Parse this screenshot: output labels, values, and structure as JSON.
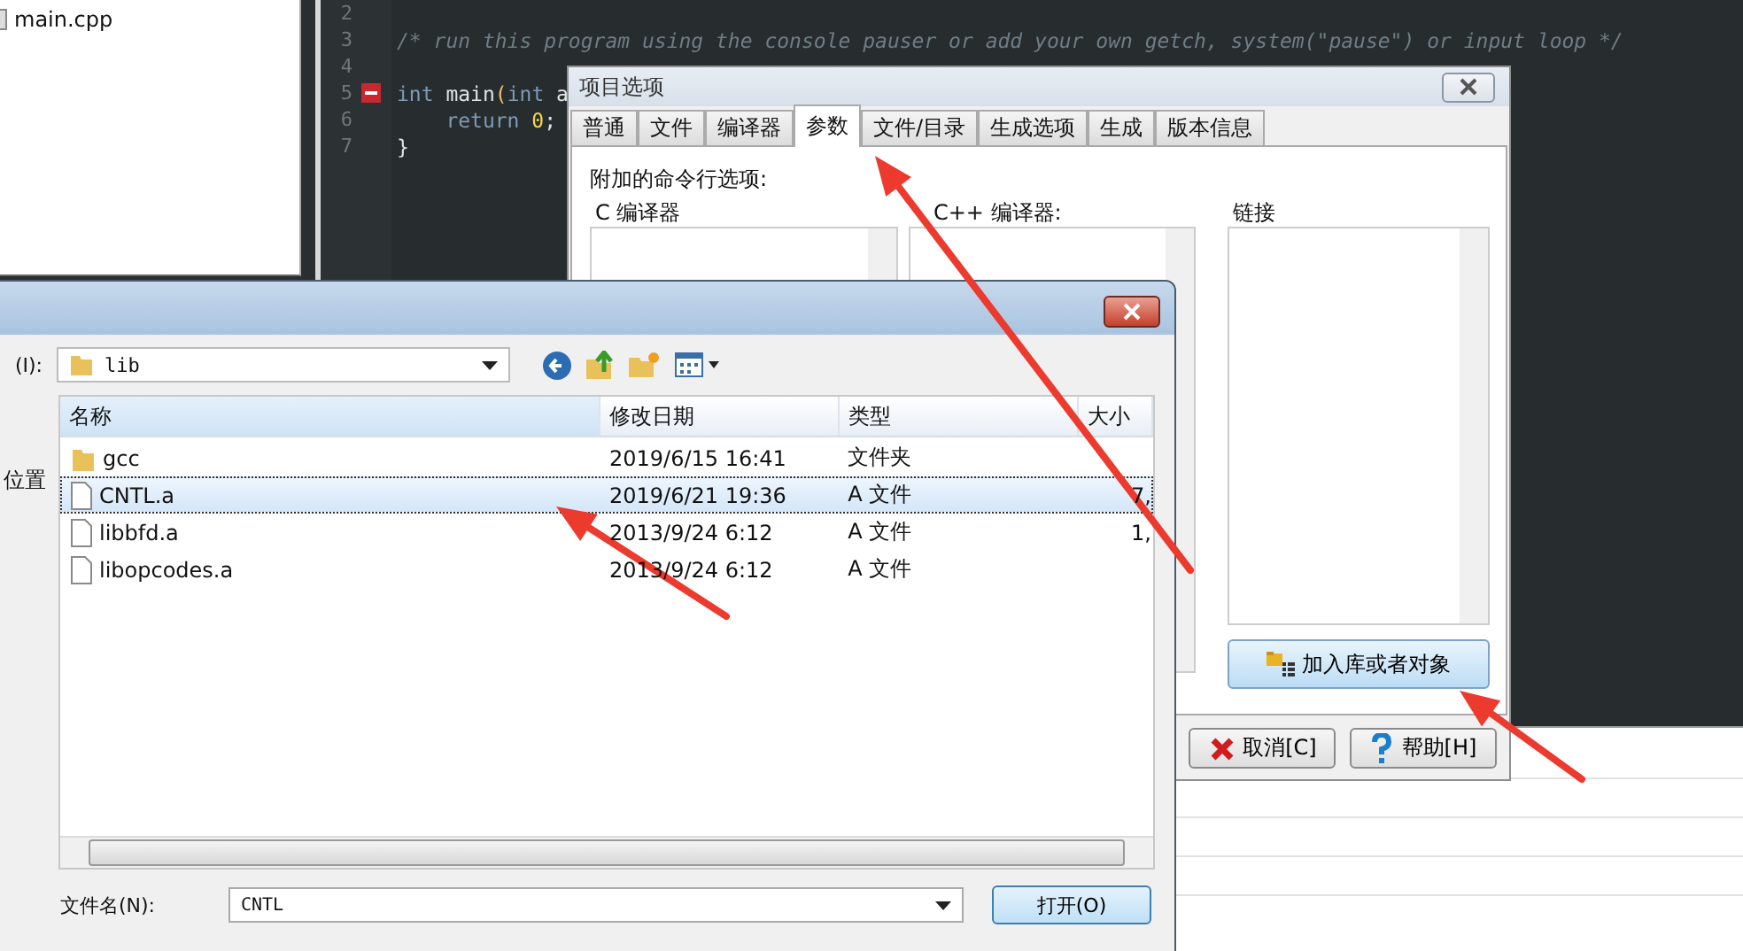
{
  "project_tree": {
    "items": [
      {
        "label": "main.cpp"
      }
    ]
  },
  "editor": {
    "lines": [
      {
        "number": "2"
      },
      {
        "number": "3",
        "tokens": [
          {
            "text": "/* run this program using the console pauser or add your own getch, system(\"pause\") or input loop */",
            "kind": "comment"
          }
        ]
      },
      {
        "number": "4"
      },
      {
        "number": "5",
        "fold": {
          "expanded": true
        },
        "tokens": [
          {
            "text": "int",
            "kind": "keyword"
          },
          {
            "text": " main",
            "kind": "plain"
          },
          {
            "text": "(",
            "kind": "paren"
          },
          {
            "text": "int",
            "kind": "keyword"
          },
          {
            "text": " a",
            "kind": "plain"
          }
        ]
      },
      {
        "number": "6",
        "tokens": [
          {
            "text": "    return",
            "kind": "keyword"
          },
          {
            "text": " 0",
            "kind": "number"
          },
          {
            "text": ";",
            "kind": "plain"
          }
        ]
      },
      {
        "number": "7",
        "tokens": [
          {
            "text": "}",
            "kind": "plain"
          }
        ]
      }
    ]
  },
  "project_options": {
    "title": "项目选项",
    "tabs": [
      {
        "label": "普通",
        "selected": false
      },
      {
        "label": "文件",
        "selected": false
      },
      {
        "label": "编译器",
        "selected": false
      },
      {
        "label": "参数",
        "selected": true
      },
      {
        "label": "文件/目录",
        "selected": false
      },
      {
        "label": "生成选项",
        "selected": false
      },
      {
        "label": "生成",
        "selected": false
      },
      {
        "label": "版本信息",
        "selected": false
      }
    ],
    "section_label": "附加的命令行选项:",
    "columns": [
      {
        "label": "C 编译器"
      },
      {
        "label": "C++ 编译器:"
      },
      {
        "label": "链接"
      }
    ],
    "add_button": "加入库或者对象",
    "buttons": [
      {
        "label": "取消[C]",
        "kind": "cancel"
      },
      {
        "label": "帮助[H]",
        "kind": "help"
      }
    ]
  },
  "file_dialog": {
    "look_in_label": "(I):",
    "look_in": "lib",
    "nav_label": "位置",
    "columns": [
      "名称",
      "修改日期",
      "类型",
      "大小"
    ],
    "rows": [
      {
        "name": "gcc",
        "date": "2019/6/15 16:41",
        "type": "文件夹",
        "kind": "folder",
        "selected": false
      },
      {
        "name": "CNTL.a",
        "date": "2019/6/21 19:36",
        "type": "A 文件",
        "size": "7,",
        "kind": "file",
        "selected": true
      },
      {
        "name": "libbfd.a",
        "date": "2013/9/24 6:12",
        "type": "A 文件",
        "size": "1,",
        "kind": "file",
        "selected": false
      },
      {
        "name": "libopcodes.a",
        "date": "2013/9/24 6:12",
        "type": "A 文件",
        "kind": "file",
        "selected": false
      }
    ],
    "filename_label": "文件名(N):",
    "filename": "CNTL",
    "open_button": "打开(O)"
  }
}
